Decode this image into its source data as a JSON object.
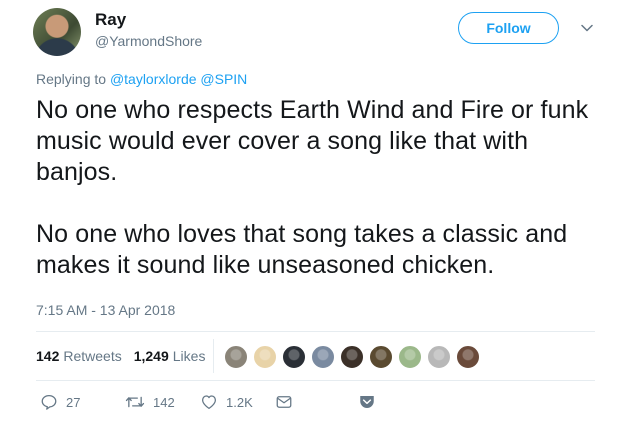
{
  "author": {
    "name": "Ray",
    "handle": "@YarmondShore"
  },
  "follow_label": "Follow",
  "reply_prefix": "Replying to ",
  "reply_mentions": [
    "@taylorxlorde",
    "@SPIN"
  ],
  "tweet": {
    "paragraph1": "No one who respects Earth Wind and Fire or funk music would ever cover a song like that with banjos.",
    "paragraph2": "No one who loves that song takes a classic and makes it sound like unseasoned chicken."
  },
  "timestamp": "7:15 AM - 13 Apr 2018",
  "stats": {
    "retweets_count": "142",
    "retweets_label": "Retweets",
    "likes_count": "1,249",
    "likes_label": "Likes"
  },
  "likers": [
    {
      "color": "#8a8478"
    },
    {
      "color": "#e8d3a8"
    },
    {
      "color": "#2a2f36"
    },
    {
      "color": "#7a8aa0"
    },
    {
      "color": "#3b3028"
    },
    {
      "color": "#5a4a30"
    },
    {
      "color": "#9bb88a"
    },
    {
      "color": "#b8b8b8"
    },
    {
      "color": "#6a4a3a"
    }
  ],
  "actions": {
    "reply_count": "27",
    "retweet_count": "142",
    "like_count": "1.2K"
  },
  "colors": {
    "accent": "#1da1f2",
    "text": "#14171a",
    "secondary": "#657786"
  }
}
